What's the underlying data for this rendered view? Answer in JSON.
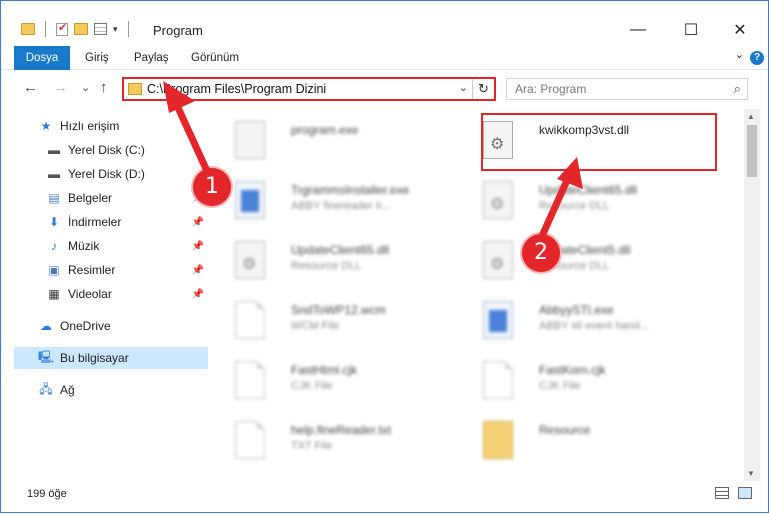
{
  "window": {
    "title": "Program",
    "close": "✕",
    "maximize": "☐",
    "minimize": "—"
  },
  "ribbon": {
    "tabs": [
      "Dosya",
      "Giriş",
      "Paylaş",
      "Görünüm"
    ],
    "expand": "⌄",
    "help": "?"
  },
  "nav": {
    "back": "←",
    "forward": "→",
    "recent": "⌄",
    "up": "↑"
  },
  "address": {
    "path": "C:\\Program Files\\Program Dizini",
    "dropdown": "⌄",
    "refresh": "↻"
  },
  "search": {
    "placeholder": "Ara: Program",
    "icon": "⌕"
  },
  "sidebar": {
    "items": [
      {
        "label": "Hızlı erişim",
        "icon": "star-icon",
        "glyph": "★",
        "color": "#2b7bd8"
      },
      {
        "label": "Yerel Disk (C:)",
        "icon": "drive-icon",
        "glyph": "▬",
        "color": "#555"
      },
      {
        "label": "Yerel Disk (D:)",
        "icon": "drive-icon",
        "glyph": "▬",
        "color": "#555"
      },
      {
        "label": "Belgeler",
        "icon": "documents-icon",
        "glyph": "▤",
        "color": "#4a79b8",
        "pinned": true
      },
      {
        "label": "İndirmeler",
        "icon": "download-icon",
        "glyph": "⬇",
        "color": "#2b7bd8",
        "pinned": true
      },
      {
        "label": "Müzik",
        "icon": "music-icon",
        "glyph": "♪",
        "color": "#2b7bd8",
        "pinned": true
      },
      {
        "label": "Resimler",
        "icon": "pictures-icon",
        "glyph": "▣",
        "color": "#4a79b8",
        "pinned": true
      },
      {
        "label": "Videolar",
        "icon": "videos-icon",
        "glyph": "▦",
        "color": "#333",
        "pinned": true
      },
      {
        "label": "OneDrive",
        "icon": "cloud-icon",
        "glyph": "☁",
        "color": "#2b7bd8"
      },
      {
        "label": "Bu bilgisayar",
        "icon": "computer-icon",
        "glyph": "🖳",
        "color": "#2b7bd8",
        "selected": true
      },
      {
        "label": "Ağ",
        "icon": "network-icon",
        "glyph": "🖧",
        "color": "#2b7bd8"
      }
    ],
    "pin_glyph": "📌"
  },
  "files": [
    {
      "name": "program.exe",
      "type": "",
      "kind": "exe-gray",
      "blur": true
    },
    {
      "name": "kwikkomp3vst.dll",
      "type": "",
      "kind": "dll",
      "blur": false
    },
    {
      "name": "TrgrammsInstaller.exe",
      "type": "ABBY finereader tr...",
      "kind": "exe",
      "blur": true
    },
    {
      "name": "UpdateClient65.dll",
      "type": "Resource DLL",
      "kind": "dll",
      "blur": true
    },
    {
      "name": "UpdateClient65.dll",
      "type": "Resource DLL",
      "kind": "dll",
      "blur": true
    },
    {
      "name": "UpdateClient5.dll",
      "type": "Resource DLL",
      "kind": "dll",
      "blur": true
    },
    {
      "name": "SndToWP12.wcm",
      "type": "WCM File",
      "kind": "doc",
      "blur": true
    },
    {
      "name": "AbbyySTI.exe",
      "type": "ABBY sti event hand...",
      "kind": "exe",
      "blur": true
    },
    {
      "name": "FastHtml.cjk",
      "type": "CJK File",
      "kind": "doc",
      "blur": true
    },
    {
      "name": "FastKorn.cjk",
      "type": "CJK File",
      "kind": "doc",
      "blur": true
    },
    {
      "name": "help.fineReader.txt",
      "type": "TXT File",
      "kind": "doc",
      "blur": true
    },
    {
      "name": "Resource",
      "type": "",
      "kind": "folder",
      "blur": true
    }
  ],
  "callouts": [
    "1",
    "2"
  ],
  "status": {
    "count": "199 öğe"
  },
  "colors": {
    "accent": "#1979ca",
    "highlight": "#e2262a",
    "selected": "#cce8ff"
  }
}
